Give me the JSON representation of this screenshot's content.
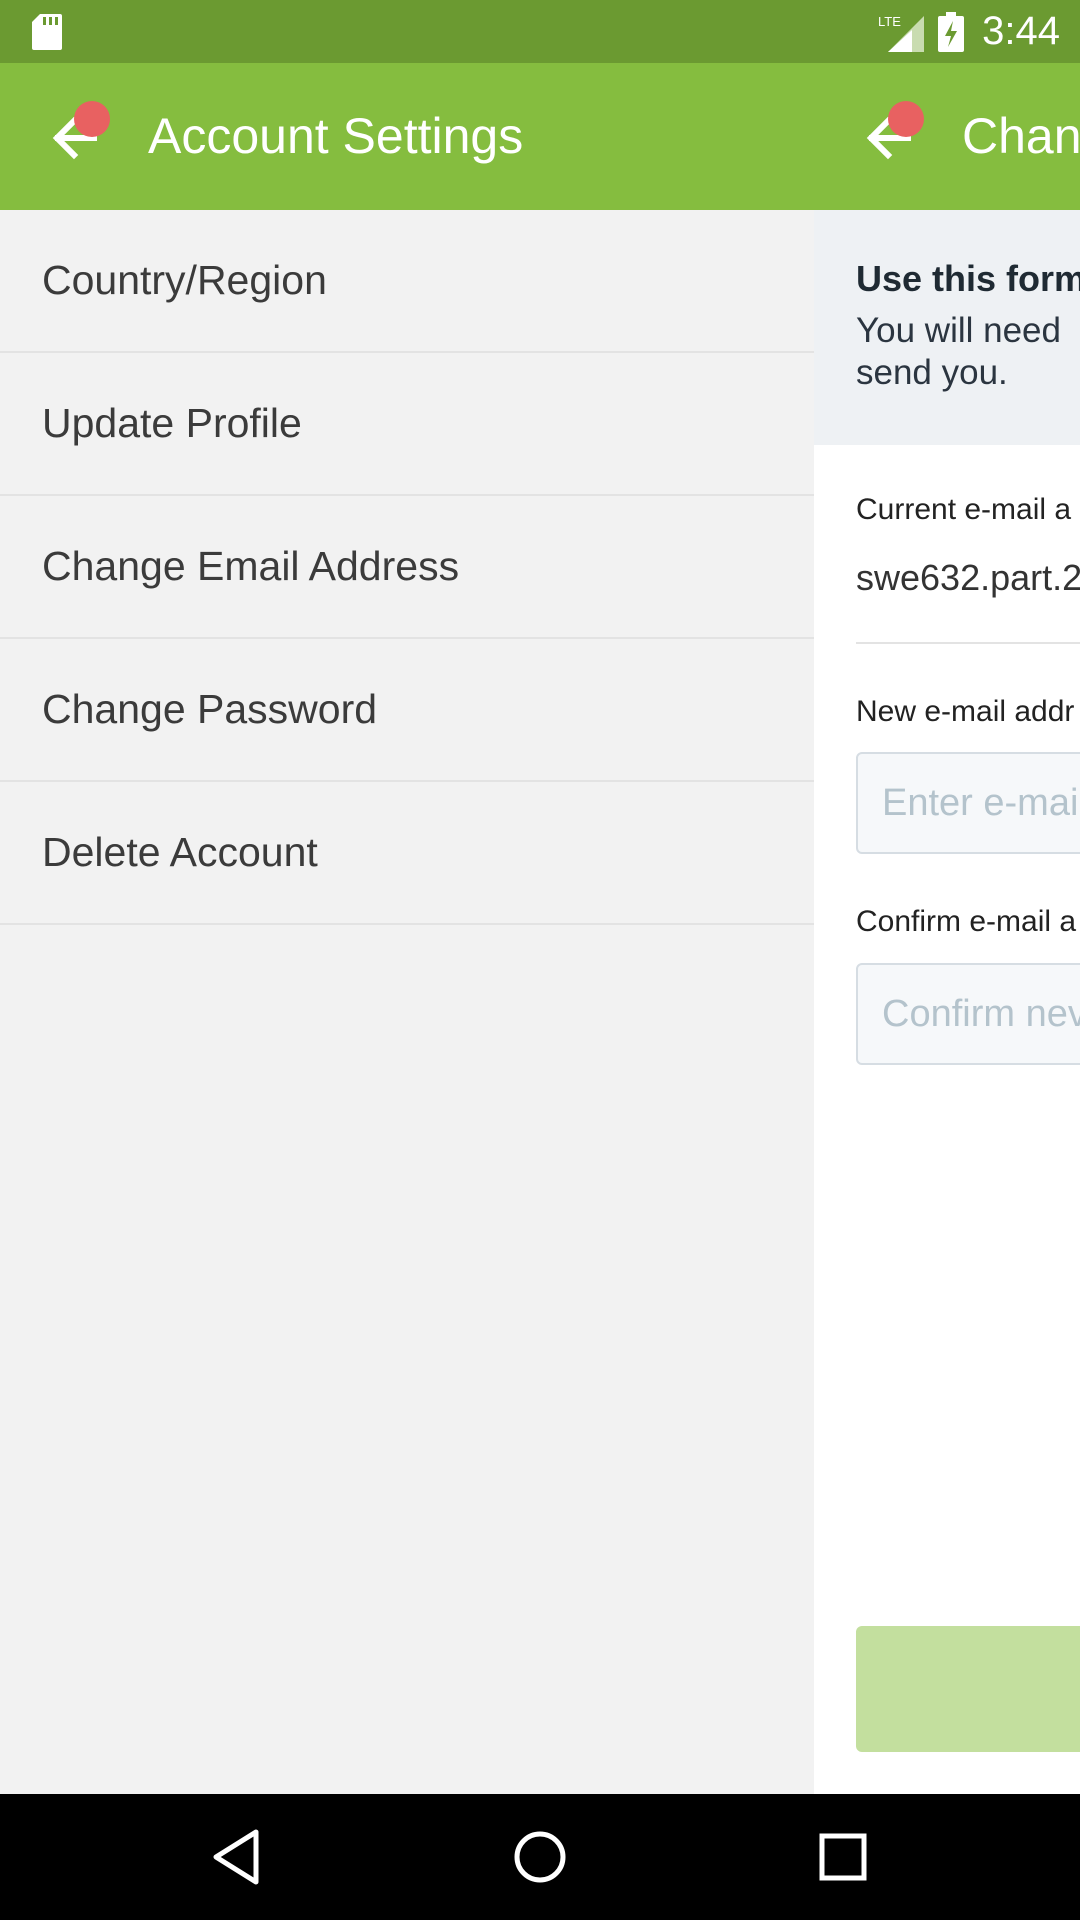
{
  "status_bar": {
    "time": "3:44",
    "network": "LTE"
  },
  "left": {
    "title": "Account Settings",
    "menu_items": [
      {
        "label": "Country/Region"
      },
      {
        "label": "Update Profile"
      },
      {
        "label": "Change Email Address"
      },
      {
        "label": "Change Password"
      },
      {
        "label": "Delete Account"
      }
    ]
  },
  "right": {
    "title": "Chan",
    "info_title": "Use this form",
    "info_line1": "You will need",
    "info_line2": "send you.",
    "current_label": "Current e-mail a",
    "current_value": "swe632.part.2",
    "new_label": "New e-mail addr",
    "new_placeholder": "Enter e-mai",
    "confirm_label": "Confirm e-mail a",
    "confirm_placeholder": "Confirm nev"
  },
  "colors": {
    "status_bar": "#6b9a31",
    "app_bar": "#85bd3f",
    "notification_dot": "#e86161",
    "submit_button": "#c3df9e"
  },
  "icons": {
    "sd_card": "sd-card-icon",
    "back": "back-arrow-icon",
    "nav_back": "nav-back-icon",
    "nav_home": "nav-home-icon",
    "nav_recents": "nav-recents-icon"
  }
}
